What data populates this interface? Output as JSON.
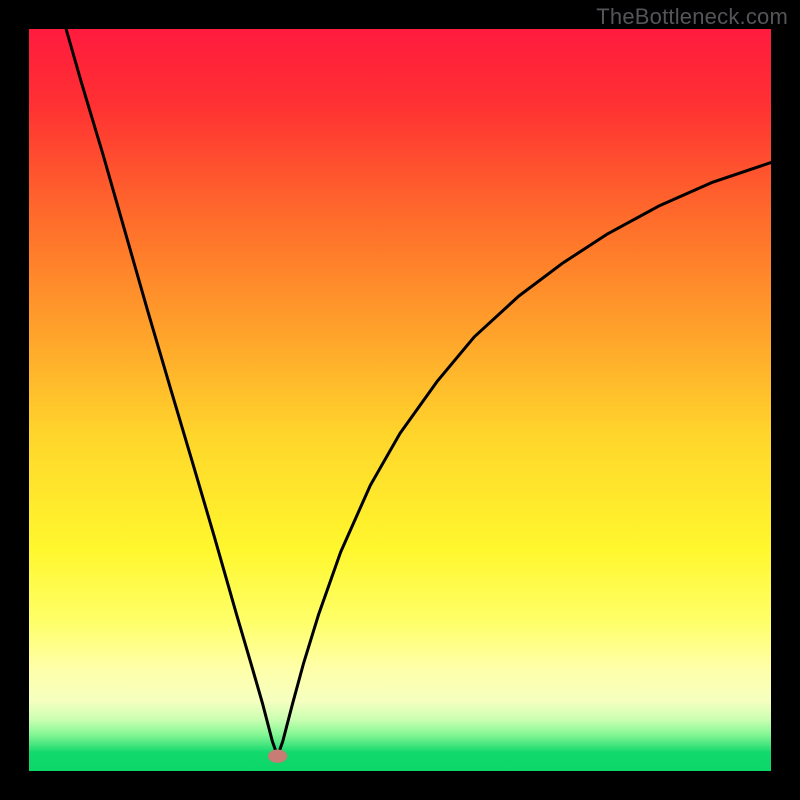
{
  "watermark": "TheBottleneck.com",
  "chart_data": {
    "type": "line",
    "title": "",
    "xlabel": "",
    "ylabel": "",
    "xlim": [
      0,
      100
    ],
    "ylim": [
      0,
      100
    ],
    "plot_background": {
      "type": "vertical-gradient",
      "stops": [
        {
          "offset": 0.0,
          "color": "#ff1b3e"
        },
        {
          "offset": 0.1,
          "color": "#ff3033"
        },
        {
          "offset": 0.25,
          "color": "#ff6a2b"
        },
        {
          "offset": 0.4,
          "color": "#ff9f2b"
        },
        {
          "offset": 0.55,
          "color": "#ffd62b"
        },
        {
          "offset": 0.7,
          "color": "#fff72d"
        },
        {
          "offset": 0.8,
          "color": "#ffff6a"
        },
        {
          "offset": 0.86,
          "color": "#ffffa8"
        },
        {
          "offset": 0.905,
          "color": "#f6ffbf"
        },
        {
          "offset": 0.93,
          "color": "#ccffb3"
        },
        {
          "offset": 0.95,
          "color": "#88f796"
        },
        {
          "offset": 0.965,
          "color": "#44e57e"
        },
        {
          "offset": 0.975,
          "color": "#12d96c"
        },
        {
          "offset": 1.0,
          "color": "#0bd768"
        }
      ]
    },
    "curve": {
      "type": "absolute-value-like",
      "description": "Sharp V-shaped curve; left branch nearly straight, right branch concave (sqrt-like) rising.",
      "minimum": {
        "x": 33.5,
        "y": 2
      },
      "series": [
        {
          "x": 5.0,
          "y": 100.0
        },
        {
          "x": 7.0,
          "y": 93.0
        },
        {
          "x": 10.0,
          "y": 83.0
        },
        {
          "x": 13.0,
          "y": 72.5
        },
        {
          "x": 16.0,
          "y": 62.0
        },
        {
          "x": 19.0,
          "y": 51.8
        },
        {
          "x": 22.0,
          "y": 41.7
        },
        {
          "x": 25.0,
          "y": 31.5
        },
        {
          "x": 28.0,
          "y": 21.0
        },
        {
          "x": 30.0,
          "y": 14.2
        },
        {
          "x": 31.5,
          "y": 9.0
        },
        {
          "x": 32.8,
          "y": 4.0
        },
        {
          "x": 33.5,
          "y": 2.0
        },
        {
          "x": 34.2,
          "y": 4.0
        },
        {
          "x": 35.5,
          "y": 9.0
        },
        {
          "x": 37.0,
          "y": 14.5
        },
        {
          "x": 39.0,
          "y": 21.0
        },
        {
          "x": 42.0,
          "y": 29.5
        },
        {
          "x": 46.0,
          "y": 38.5
        },
        {
          "x": 50.0,
          "y": 45.5
        },
        {
          "x": 55.0,
          "y": 52.5
        },
        {
          "x": 60.0,
          "y": 58.5
        },
        {
          "x": 66.0,
          "y": 64.0
        },
        {
          "x": 72.0,
          "y": 68.5
        },
        {
          "x": 78.0,
          "y": 72.4
        },
        {
          "x": 85.0,
          "y": 76.2
        },
        {
          "x": 92.0,
          "y": 79.3
        },
        {
          "x": 100.0,
          "y": 82.0
        }
      ]
    },
    "marker": {
      "x": 33.5,
      "y": 2.0,
      "color": "#c77c74",
      "rx": 1.3,
      "ry": 0.9
    }
  }
}
